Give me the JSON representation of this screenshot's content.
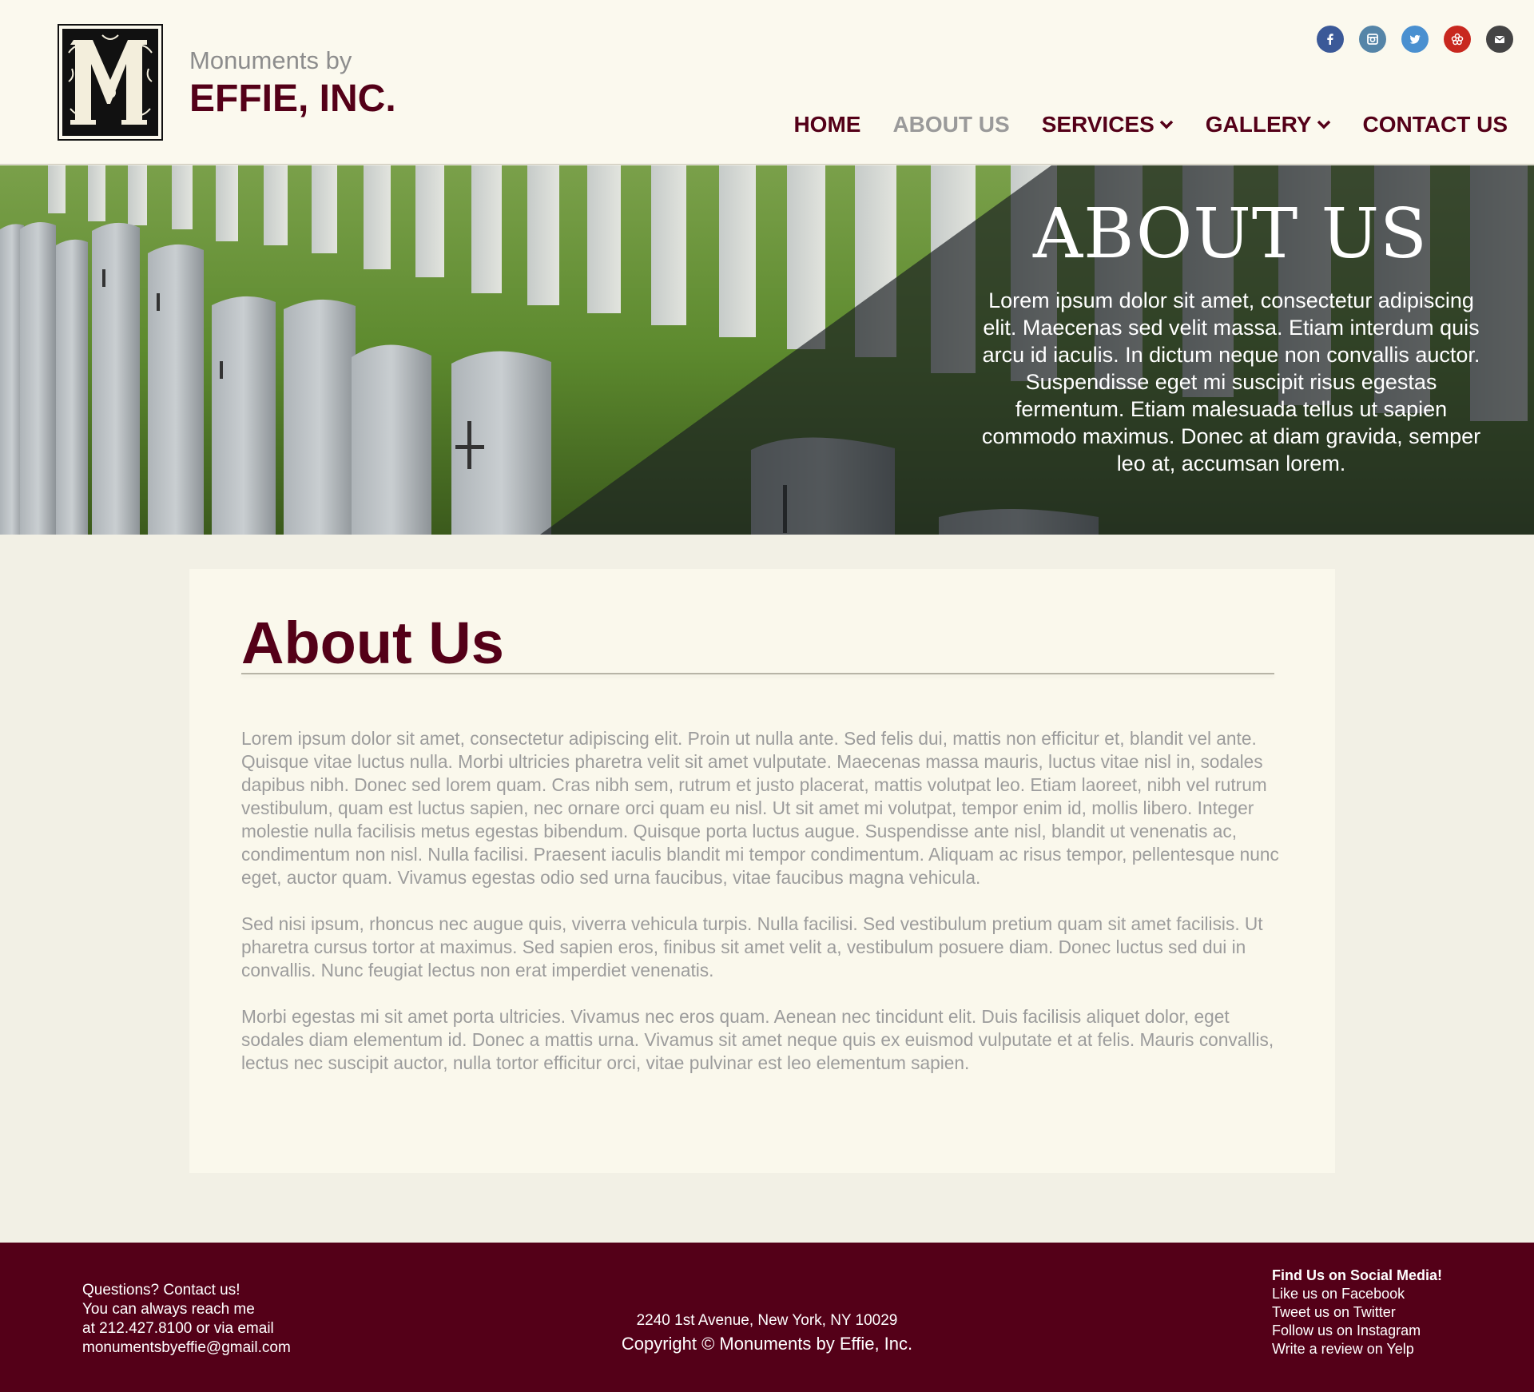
{
  "brand": {
    "line1": "Monuments by",
    "line2": "EFFIE, INC."
  },
  "social_icons": [
    {
      "name": "facebook-icon",
      "color": "#3b5998"
    },
    {
      "name": "instagram-icon",
      "color": "#5585a8"
    },
    {
      "name": "twitter-icon",
      "color": "#4a90d0"
    },
    {
      "name": "yelp-icon",
      "color": "#c8281f"
    },
    {
      "name": "email-icon",
      "color": "#444444"
    }
  ],
  "nav": {
    "home": "HOME",
    "about": "ABOUT US",
    "services": "SERVICES",
    "gallery": "GALLERY",
    "contact": "CONTACT US"
  },
  "hero": {
    "title": "ABOUT US",
    "text": "Lorem ipsum dolor sit amet, consectetur adipiscing elit. Maecenas sed velit massa. Etiam interdum quis arcu id iaculis. In dictum neque non convallis auctor. Suspendisse eget mi suscipit risus egestas fermentum. Etiam malesuada tellus ut sapien commodo maximus. Donec at diam gravida, semper leo at, accumsan lorem."
  },
  "main": {
    "title": "About Us",
    "paragraphs": [
      "Lorem ipsum dolor sit amet, consectetur adipiscing elit. Proin ut nulla ante. Sed felis dui, mattis non efficitur et, blandit vel ante. Quisque vitae luctus nulla. Morbi ultricies pharetra velit sit amet vulputate. Maecenas massa mauris, luctus vitae nisl in, sodales dapibus nibh. Donec sed lorem quam. Cras nibh sem, rutrum et justo placerat, mattis volutpat leo. Etiam laoreet, nibh vel rutrum vestibulum, quam est luctus sapien, nec ornare orci quam eu nisl. Ut sit amet mi volutpat, tempor enim id, mollis libero. Integer molestie nulla facilisis metus egestas bibendum. Quisque porta luctus augue. Suspendisse ante nisl, blandit ut venenatis ac, condimentum non nisl. Nulla facilisi. Praesent iaculis blandit mi tempor condimentum. Aliquam ac risus tempor, pellentesque nunc eget, auctor quam. Vivamus egestas odio sed urna faucibus, vitae faucibus magna vehicula.",
      "Sed nisi ipsum, rhoncus nec augue quis, viverra vehicula turpis. Nulla facilisi. Sed vestibulum pretium quam sit amet facilisis. Ut pharetra cursus tortor at maximus. Sed sapien eros, finibus sit amet velit a, vestibulum posuere diam. Donec luctus sed dui in convallis. Nunc feugiat lectus non erat imperdiet venenatis.",
      "Morbi egestas mi sit amet porta ultricies. Vivamus nec eros quam. Aenean nec tincidunt elit. Duis facilisis aliquet dolor, eget sodales diam elementum id. Donec a mattis urna. Vivamus sit amet neque quis ex euismod vulputate et at felis. Mauris convallis, lectus nec suscipit auctor, nulla tortor efficitur orci, vitae pulvinar est leo elementum sapien."
    ]
  },
  "footer": {
    "contact": {
      "line1": "Questions? Contact us!",
      "line2": "You can always reach me",
      "line3": "at 212.427.8100 or via email",
      "line4": "monumentsbyeffie@gmail.com"
    },
    "address": "2240 1st Avenue, New York, NY 10029",
    "copyright": "Copyright © Monuments by Effie, Inc.",
    "social": {
      "heading": "Find Us on Social Media!",
      "facebook": "Like us on Facebook",
      "twitter": "Tweet us on Twitter",
      "instagram": "Follow us on Instagram",
      "yelp": "Write a review on Yelp"
    }
  },
  "colors": {
    "brand": "#540018",
    "nav_active": "#9a9a9a",
    "header_bg": "#fbf9ee",
    "page_bg": "#f2f0e5",
    "body_text": "#9c9c9c"
  }
}
